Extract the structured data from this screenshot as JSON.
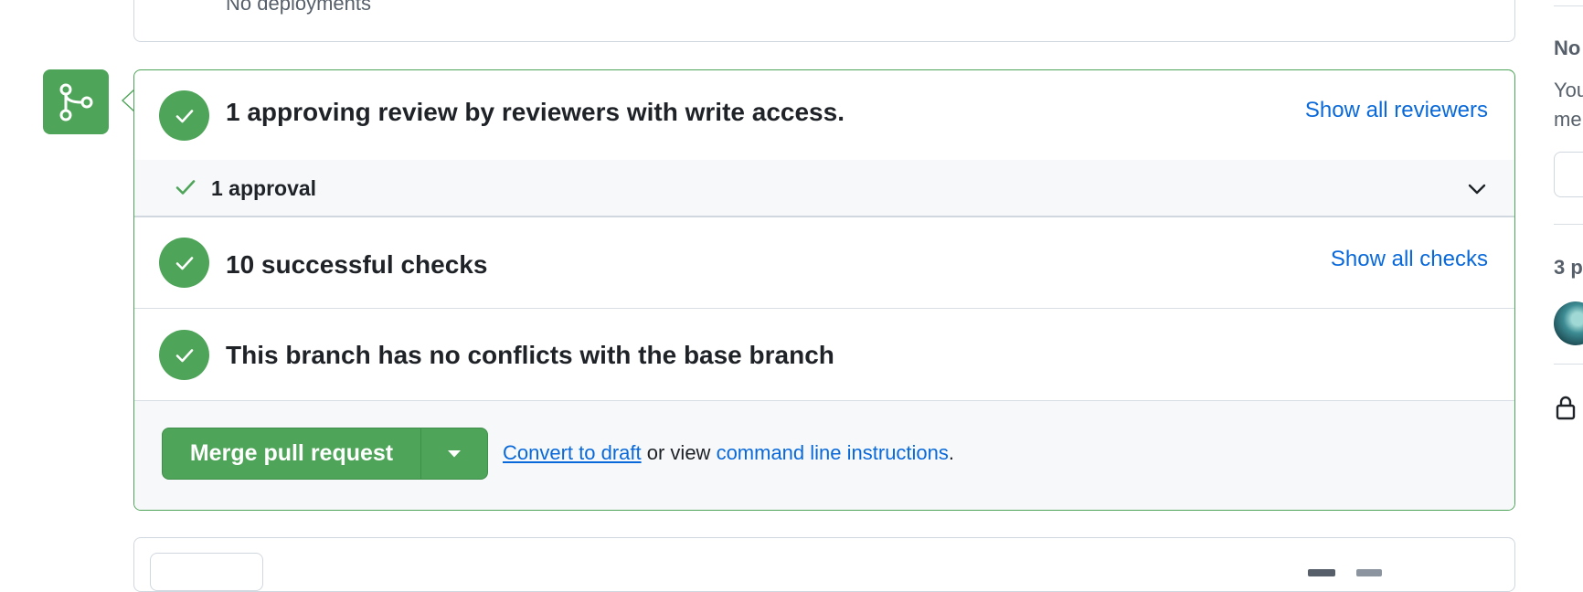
{
  "deployments": {
    "text": "No deployments"
  },
  "review": {
    "heading": "1 approving review by reviewers with write access.",
    "link": "Show all reviewers"
  },
  "approval": {
    "label": "1 approval"
  },
  "checks": {
    "heading": "10 successful checks",
    "link": "Show all checks"
  },
  "conflicts": {
    "heading": "This branch has no conflicts with the base branch"
  },
  "actions": {
    "merge_label": "Merge pull request",
    "convert_link": "Convert to draft",
    "or_view": " or view ",
    "cli_link": "command line instructions",
    "period": "."
  },
  "sidebar": {
    "notifications_title": "No",
    "notifications_text_1": "You",
    "notifications_text_2": "me",
    "participants_title": "3 p"
  },
  "colors": {
    "success": "#4ea458",
    "link": "#0969da",
    "text": "#1f2328",
    "muted": "#57606a"
  },
  "icons": {
    "merge": "git-merge-icon",
    "status": "check-circle-icon",
    "approval": "check-icon",
    "expand": "chevron-down-icon",
    "dropdown": "triangle-down-icon",
    "lock": "lock-icon"
  }
}
